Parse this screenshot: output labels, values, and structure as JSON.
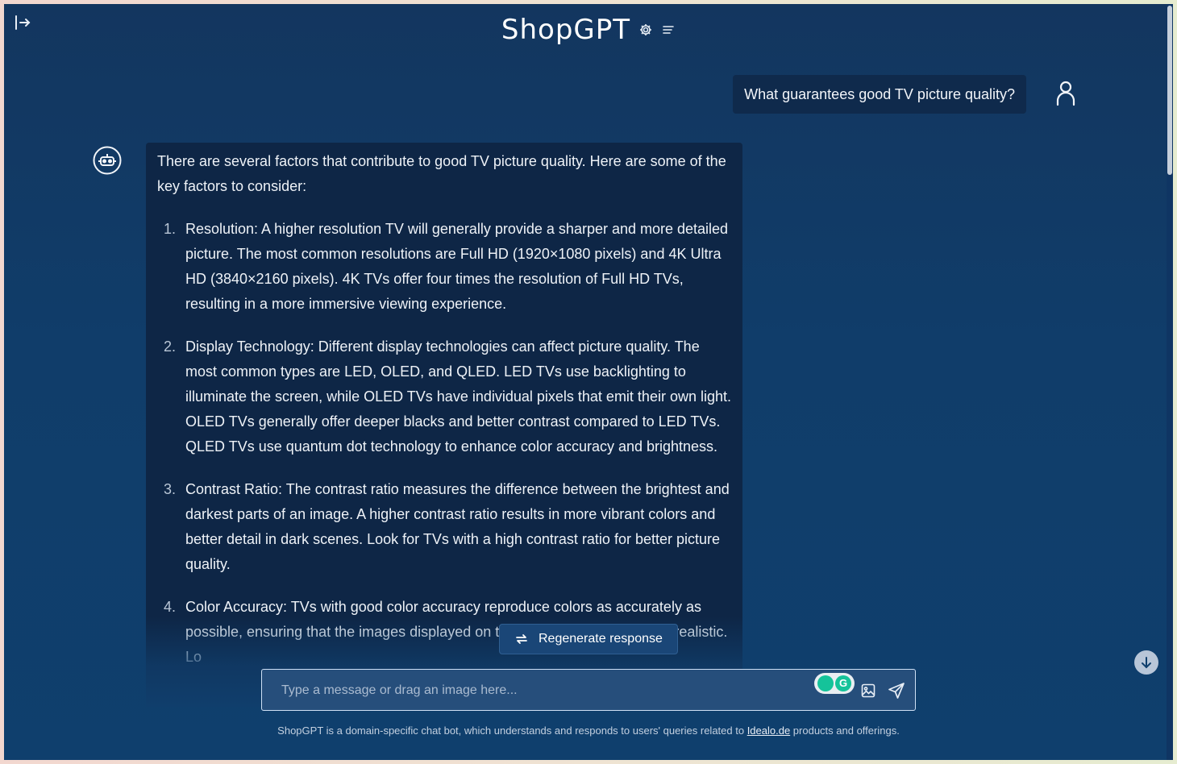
{
  "app": {
    "title": "ShopGPT",
    "colors": {
      "background": "#103d6a",
      "bubble": "#0e2646",
      "accent": "#15c39a"
    }
  },
  "header": {
    "settings_icon": "gear-icon",
    "menu_icon": "lines-icon",
    "sidebar_icon": "sidebar-open-icon"
  },
  "conversation": {
    "user_message": "What guarantees good TV picture quality?",
    "bot_intro": "There are several factors that contribute to good TV picture quality. Here are some of the key factors to consider:",
    "items": [
      {
        "num": "1.",
        "text": "Resolution: A higher resolution TV will generally provide a sharper and more detailed picture. The most common resolutions are Full HD (1920×1080 pixels) and 4K Ultra HD (3840×2160 pixels). 4K TVs offer four times the resolution of Full HD TVs, resulting in a more immersive viewing experience."
      },
      {
        "num": "2.",
        "text": "Display Technology: Different display technologies can affect picture quality. The most common types are LED, OLED, and QLED. LED TVs use backlighting to illuminate the screen, while OLED TVs have individual pixels that emit their own light. OLED TVs generally offer deeper blacks and better contrast compared to LED TVs. QLED TVs use quantum dot technology to enhance color accuracy and brightness."
      },
      {
        "num": "3.",
        "text": "Contrast Ratio: The contrast ratio measures the difference between the brightest and darkest parts of an image. A higher contrast ratio results in more vibrant colors and better detail in dark scenes. Look for TVs with a high contrast ratio for better picture quality."
      },
      {
        "num": "4.",
        "text": "Color Accuracy: TVs with good color accuracy reproduce colors as accurately as possible, ensuring that the images displayed on the screen look natural and realistic. Lo"
      }
    ]
  },
  "actions": {
    "regenerate_label": "Regenerate response"
  },
  "composer": {
    "placeholder": "Type a message or drag an image here...",
    "value": ""
  },
  "footer": {
    "text_before": "ShopGPT is a domain-specific chat bot, which understands and responds to users' queries related to ",
    "link_text": "Idealo.de",
    "text_after": " products and offerings."
  }
}
